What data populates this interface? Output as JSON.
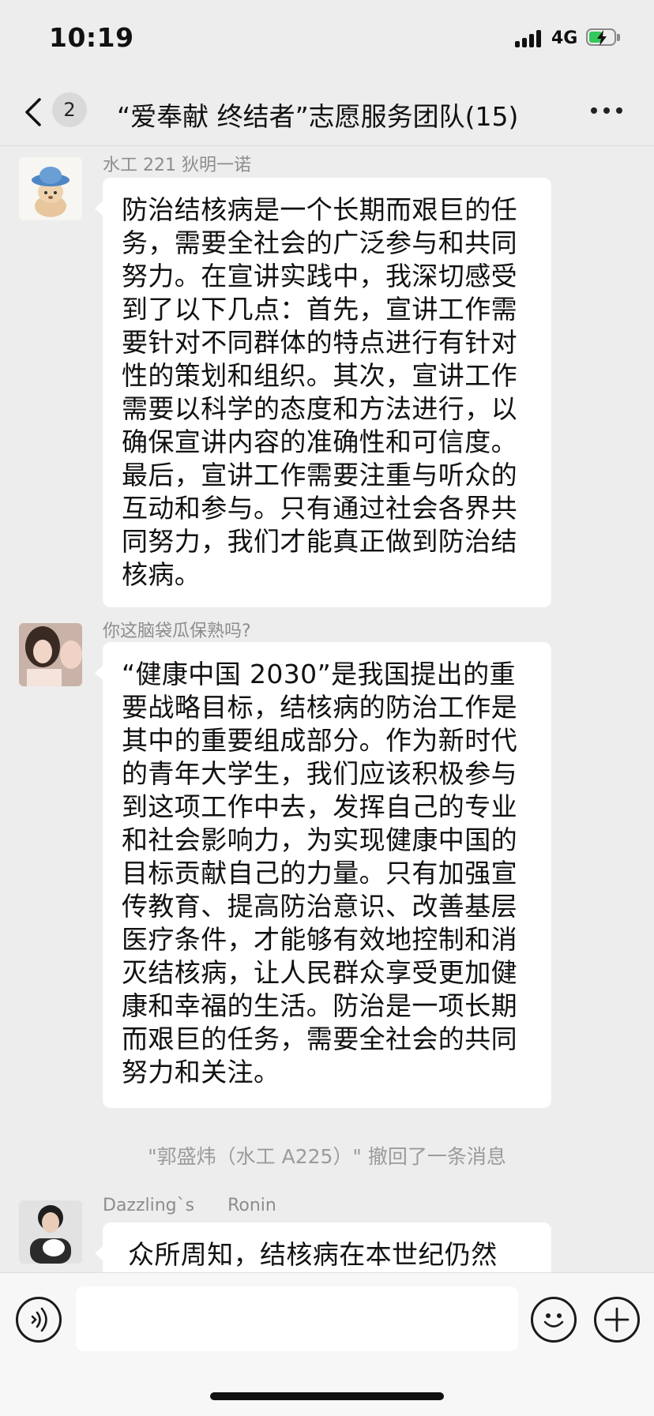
{
  "status_bar": {
    "time": "10:19",
    "network": "4G"
  },
  "nav": {
    "unread_count": "2",
    "title": "“爱奉献 终结者”志愿服务团队(15)"
  },
  "messages": [
    {
      "sender": "水工 221 狄明一诺",
      "text": "防治结核病是一个长期而艰巨的任务，需要全社会的广泛参与和共同努力。在宣讲实践中，我深切感受到了以下几点：首先，宣讲工作需要针对不同群体的特点进行有针对性的策划和组织。其次，宣讲工作需要以科学的态度和方法进行，以确保宣讲内容的准确性和可信度。最后，宣讲工作需要注重与听众的互动和参与。只有通过社会各界共同努力，我们才能真正做到防治结核病。"
    },
    {
      "sender": "你这脑袋瓜保熟吗?",
      "text": "“健康中国 2030”是我国提出的重要战略目标，结核病的防治工作是其中的重要组成部分。作为新时代的青年大学生，我们应该积极参与到这项工作中去，发挥自己的专业和社会影响力，为实现健康中国的目标贡献自己的力量。只有加强宣传教育、提高防治意识、改善基层医疗条件，才能够有效地控制和消灭结核病，让人民群众享受更加健康和幸福的生活。防治是一项长期而艰巨的任务，需要全社会的共同努力和关注。"
    },
    {
      "sender": "Dazzling`s      Ronin",
      "text": "众所周知，结核病在本世纪仍然"
    }
  ],
  "system_notice": "\"郭盛炜（水工 A225）\" 撤回了一条消息",
  "input": {
    "placeholder": ""
  },
  "colors": {
    "background": "#ededed",
    "bubble": "#ffffff",
    "battery": "#34c759"
  }
}
